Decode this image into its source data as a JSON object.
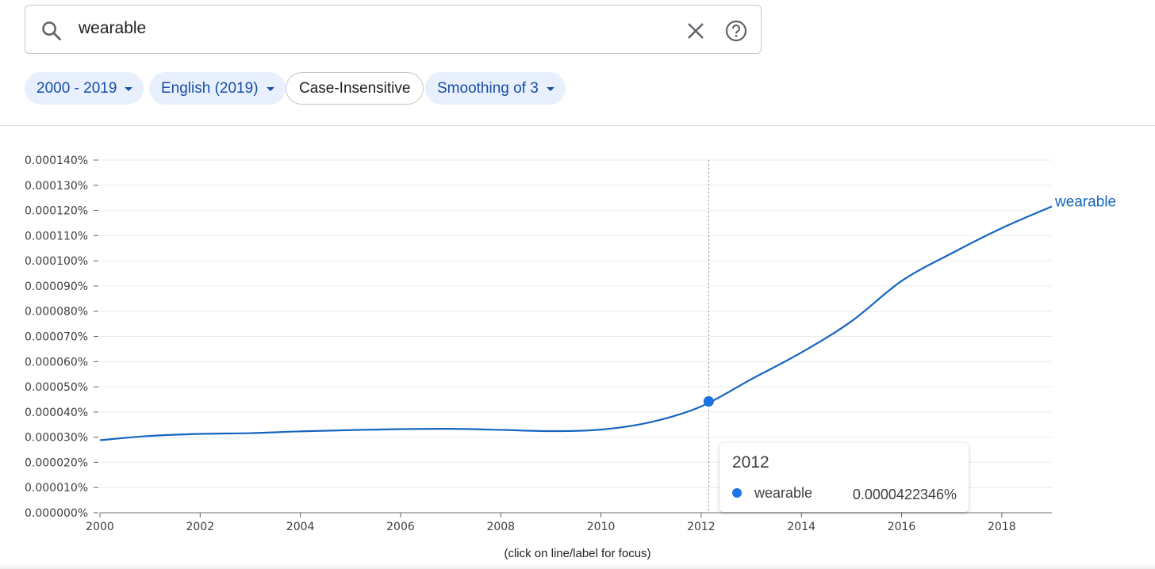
{
  "search": {
    "query": "wearable"
  },
  "filters": {
    "year_range": "2000 - 2019",
    "corpus": "English (2019)",
    "case": "Case-Insensitive",
    "smoothing": "Smoothing of 3"
  },
  "icons": {
    "search": "search-icon",
    "clear": "close-icon",
    "help": "help-icon",
    "caret": "caret-down-icon"
  },
  "colors": {
    "series": "#1565c0",
    "accent": "#1a73e8",
    "chip_bg": "#e8f0fe",
    "chip_text": "#174ea6"
  },
  "tooltip": {
    "year": "2012",
    "series_name": "wearable",
    "value": "0.0000422346%"
  },
  "footnote": "(click on line/label for focus)",
  "chart_data": {
    "type": "line",
    "title": "",
    "xlabel": "",
    "ylabel": "",
    "xlim": [
      2000,
      2019
    ],
    "ylim": [
      0,
      0.00014
    ],
    "x_ticks": [
      "2000",
      "2002",
      "2004",
      "2006",
      "2008",
      "2010",
      "2012",
      "2014",
      "2016",
      "2018"
    ],
    "y_ticks": [
      "0.000000%",
      "0.000010%",
      "0.000020%",
      "0.000030%",
      "0.000040%",
      "0.000050%",
      "0.000060%",
      "0.000070%",
      "0.000080%",
      "0.000090%",
      "0.000100%",
      "0.000110%",
      "0.000120%",
      "0.000130%",
      "0.000140%"
    ],
    "grid": true,
    "series": [
      {
        "name": "wearable",
        "x": [
          2000,
          2001,
          2002,
          2003,
          2004,
          2005,
          2006,
          2007,
          2008,
          2009,
          2010,
          2011,
          2012,
          2013,
          2014,
          2015,
          2016,
          2017,
          2018,
          2019
        ],
        "y": [
          2.88e-05,
          3.05e-05,
          3.13e-05,
          3.16e-05,
          3.23e-05,
          3.28e-05,
          3.32e-05,
          3.33e-05,
          3.29e-05,
          3.24e-05,
          3.3e-05,
          3.6e-05,
          4.22e-05,
          5.3e-05,
          6.36e-05,
          7.6e-05,
          9.2e-05,
          0.000103,
          0.000113,
          0.0001216
        ]
      }
    ],
    "highlight": {
      "x": 2012.15,
      "y": 4.42e-05
    }
  }
}
